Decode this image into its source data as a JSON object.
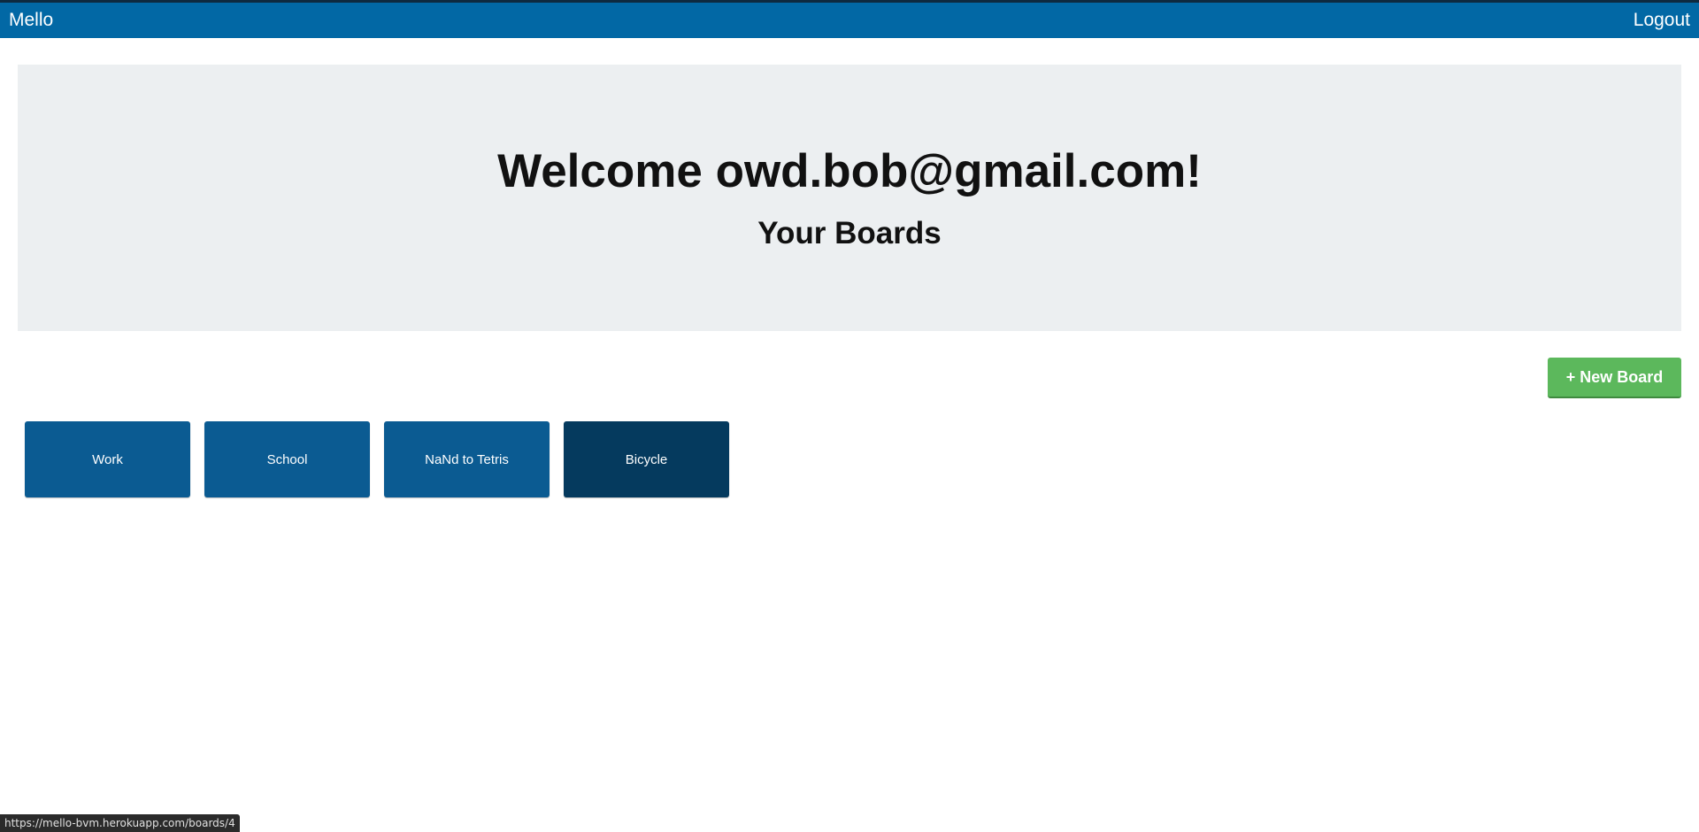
{
  "navbar": {
    "brand": "Mello",
    "logout_label": "Logout"
  },
  "hero": {
    "title": "Welcome owd.bob@gmail.com!",
    "subtitle": "Your Boards"
  },
  "actions": {
    "new_board_label": "+ New Board"
  },
  "boards": [
    {
      "label": "Work",
      "color": "#0b5b92"
    },
    {
      "label": "School",
      "color": "#0b5b92"
    },
    {
      "label": "NaNd to Tetris",
      "color": "#0b5b92"
    },
    {
      "label": "Bicycle",
      "color": "#053a5e"
    }
  ],
  "status_bar": {
    "url": "https://mello-bvm.herokuapp.com/boards/4"
  },
  "colors": {
    "navbar": "#0268a5",
    "hero_background": "#eceff1",
    "new_board_button": "#5cb85c"
  }
}
